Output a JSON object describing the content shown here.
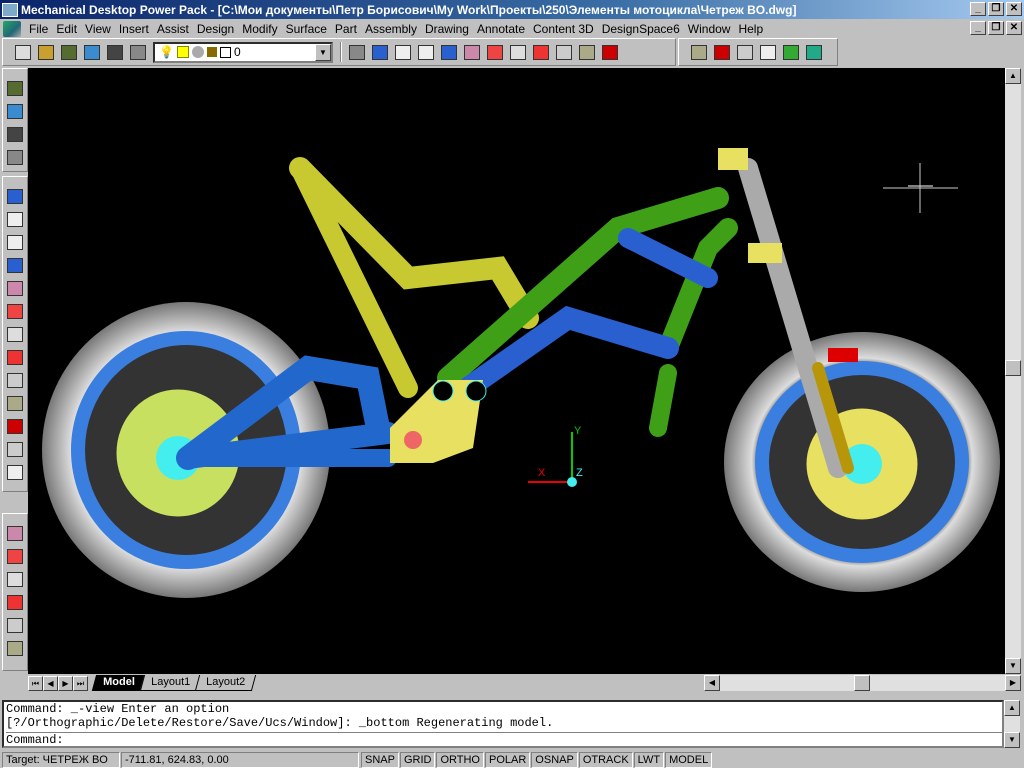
{
  "window": {
    "title": "Mechanical Desktop Power Pack - [C:\\Мои документы\\Петр Борисович\\My Work\\Проекты\\250\\Элементы мотоцикла\\Четреж BO.dwg]",
    "minimize": "_",
    "restore": "❐",
    "close": "✕"
  },
  "menu": [
    "File",
    "Edit",
    "View",
    "Insert",
    "Assist",
    "Design",
    "Modify",
    "Surface",
    "Part",
    "Assembly",
    "Drawing",
    "Annotate",
    "Content 3D",
    "DesignSpace6",
    "Window",
    "Help"
  ],
  "toolbar": {
    "layer_value": "0",
    "icons": [
      "new-icon",
      "open-icon",
      "save-icon",
      "properties-icon",
      "screen-icon",
      "layers-icon"
    ],
    "icons2": [
      "undo-icon",
      "edit-icon",
      "script-icon",
      "table-icon",
      "zoom-icon",
      "explode-icon",
      "trim-icon",
      "inspect-icon",
      "grid-icon",
      "pen-icon",
      "dimension-icon",
      "help-icon"
    ],
    "icons3": [
      "pan-icon",
      "clock-icon",
      "orbit-icon",
      "part-icon",
      "number-icon",
      "cube-icon"
    ]
  },
  "left_toolbar": {
    "group1": [
      "sketch-icon",
      "profile-icon",
      "clapper-icon",
      "dialog-icon"
    ],
    "group2": [
      "extrude-icon",
      "revolve-icon",
      "sweep-icon",
      "loft-icon",
      "move-icon",
      "bend-icon",
      "hole-icon",
      "shell-icon",
      "split-icon",
      "edit-feature-icon",
      "fillet-icon",
      "view-icon",
      "table-driven-icon"
    ],
    "group3": [
      "assembly-icon",
      "constraint-icon",
      "mate-icon",
      "insert-icon",
      "bom-icon",
      "analysis-icon"
    ]
  },
  "ucs": {
    "x": "X",
    "y": "Y",
    "z": "Z"
  },
  "tabs": [
    "Model",
    "Layout1",
    "Layout2"
  ],
  "colors": {
    "frame_yellow": "#e8e84a",
    "frame_green": "#4fb81e",
    "frame_blue": "#2a6fd8",
    "wheel_blue": "#3a7fe0",
    "tire": "#e8e8e8",
    "cyan": "#40e0e0"
  },
  "command": {
    "line1": "Command: _-view Enter an option",
    "line2": "[?/Orthographic/Delete/Restore/Save/Ucs/Window]: _bottom Regenerating model.",
    "prompt": "Command:"
  },
  "status": {
    "target": "Target: ЧЕТРЕЖ BO",
    "coords": "-711.81, 624.83, 0.00",
    "buttons": [
      "SNAP",
      "GRID",
      "ORTHO",
      "POLAR",
      "OSNAP",
      "OTRACK",
      "LWT",
      "MODEL"
    ]
  }
}
